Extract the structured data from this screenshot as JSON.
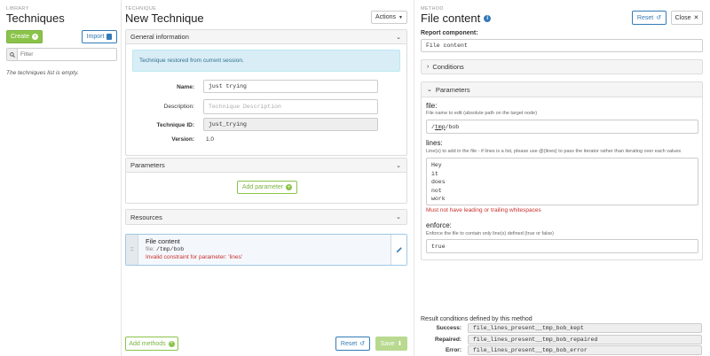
{
  "library": {
    "caption": "LIBRARY",
    "title": "Techniques",
    "create_label": "Create",
    "import_label": "Import",
    "filter_placeholder": "Filter",
    "empty_text": "The techniques list is empty."
  },
  "technique": {
    "caption": "TECHNIQUE",
    "title": "New Technique",
    "actions_label": "Actions",
    "general": {
      "header": "General information",
      "notice": "Technique restored from current session.",
      "name_label": "Name:",
      "name_value": "just trying",
      "description_label": "Description:",
      "description_placeholder": "Technique Description",
      "id_label": "Technique ID:",
      "id_value": "just_trying",
      "version_label": "Version:",
      "version_value": "1.0"
    },
    "parameters": {
      "header": "Parameters",
      "add_label": "Add parameter"
    },
    "resources": {
      "header": "Resources"
    },
    "method_call": {
      "grip": ":::",
      "title": "File content",
      "file_key": "file:",
      "file_value": "/tmp/bob",
      "error": "Invalid constraint for parameter: 'lines'"
    },
    "add_methods_label": "Add methods",
    "reset_label": "Reset",
    "save_label": "Save"
  },
  "method": {
    "caption": "METHOD",
    "title": "File content",
    "reset_label": "Reset",
    "close_label": "Close",
    "report_label": "Report component:",
    "report_value": "File content",
    "conditions_header": "Conditions",
    "parameters_header": "Parameters",
    "params": {
      "file": {
        "name": "file:",
        "help": "File name to edit (absolute path on the target node)",
        "value_prefix": "/",
        "value_link": "tmp",
        "value_suffix": "/bob"
      },
      "lines": {
        "name": "lines:",
        "help": "Line(s) to add in the file - if lines is a list, please use @{lines} to pass the iterator rather than iterating over each values",
        "values": [
          "Hey",
          "it",
          "does",
          "not",
          "work"
        ],
        "error": "Must not have leading or trailing whitespaces"
      },
      "enforce": {
        "name": "enforce:",
        "help": "Enforce the file to contain only line(s) defined (true or false)",
        "value": "true"
      }
    },
    "result": {
      "title": "Result conditions defined by this method",
      "success_label": "Success:",
      "success_value": "file_lines_present__tmp_bob_kept",
      "repaired_label": "Repaired:",
      "repaired_value": "file_lines_present__tmp_bob_repaired",
      "error_label": "Error:",
      "error_value": "file_lines_present__tmp_bob_error"
    }
  },
  "colors": {
    "accent": "#337ab7",
    "success": "#8bc34a",
    "danger": "#c9302c",
    "info_bg": "#d9edf7"
  }
}
